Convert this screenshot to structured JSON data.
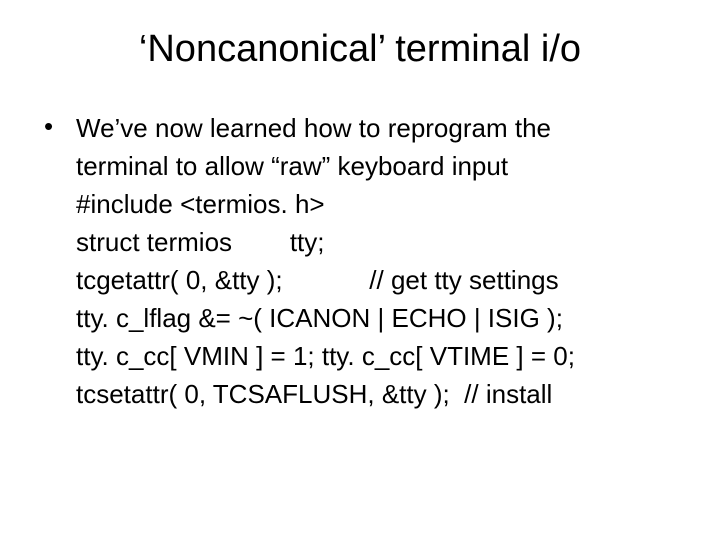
{
  "title": "‘Noncanonical’ terminal i/o",
  "bullet_glyph": "•",
  "lines": {
    "l0": "We’ve now learned how to reprogram the",
    "l1": "terminal to allow “raw” keyboard input",
    "l2": "#include <termios. h>",
    "l3": "struct termios        tty;",
    "l4": "tcgetattr( 0, &tty );            // get tty settings",
    "l5": "tty. c_lflag &= ~( ICANON | ECHO | ISIG );",
    "l6": "tty. c_cc[ VMIN ] = 1; tty. c_cc[ VTIME ] = 0;",
    "l7": "tcsetattr( 0, TCSAFLUSH, &tty );  // install"
  }
}
